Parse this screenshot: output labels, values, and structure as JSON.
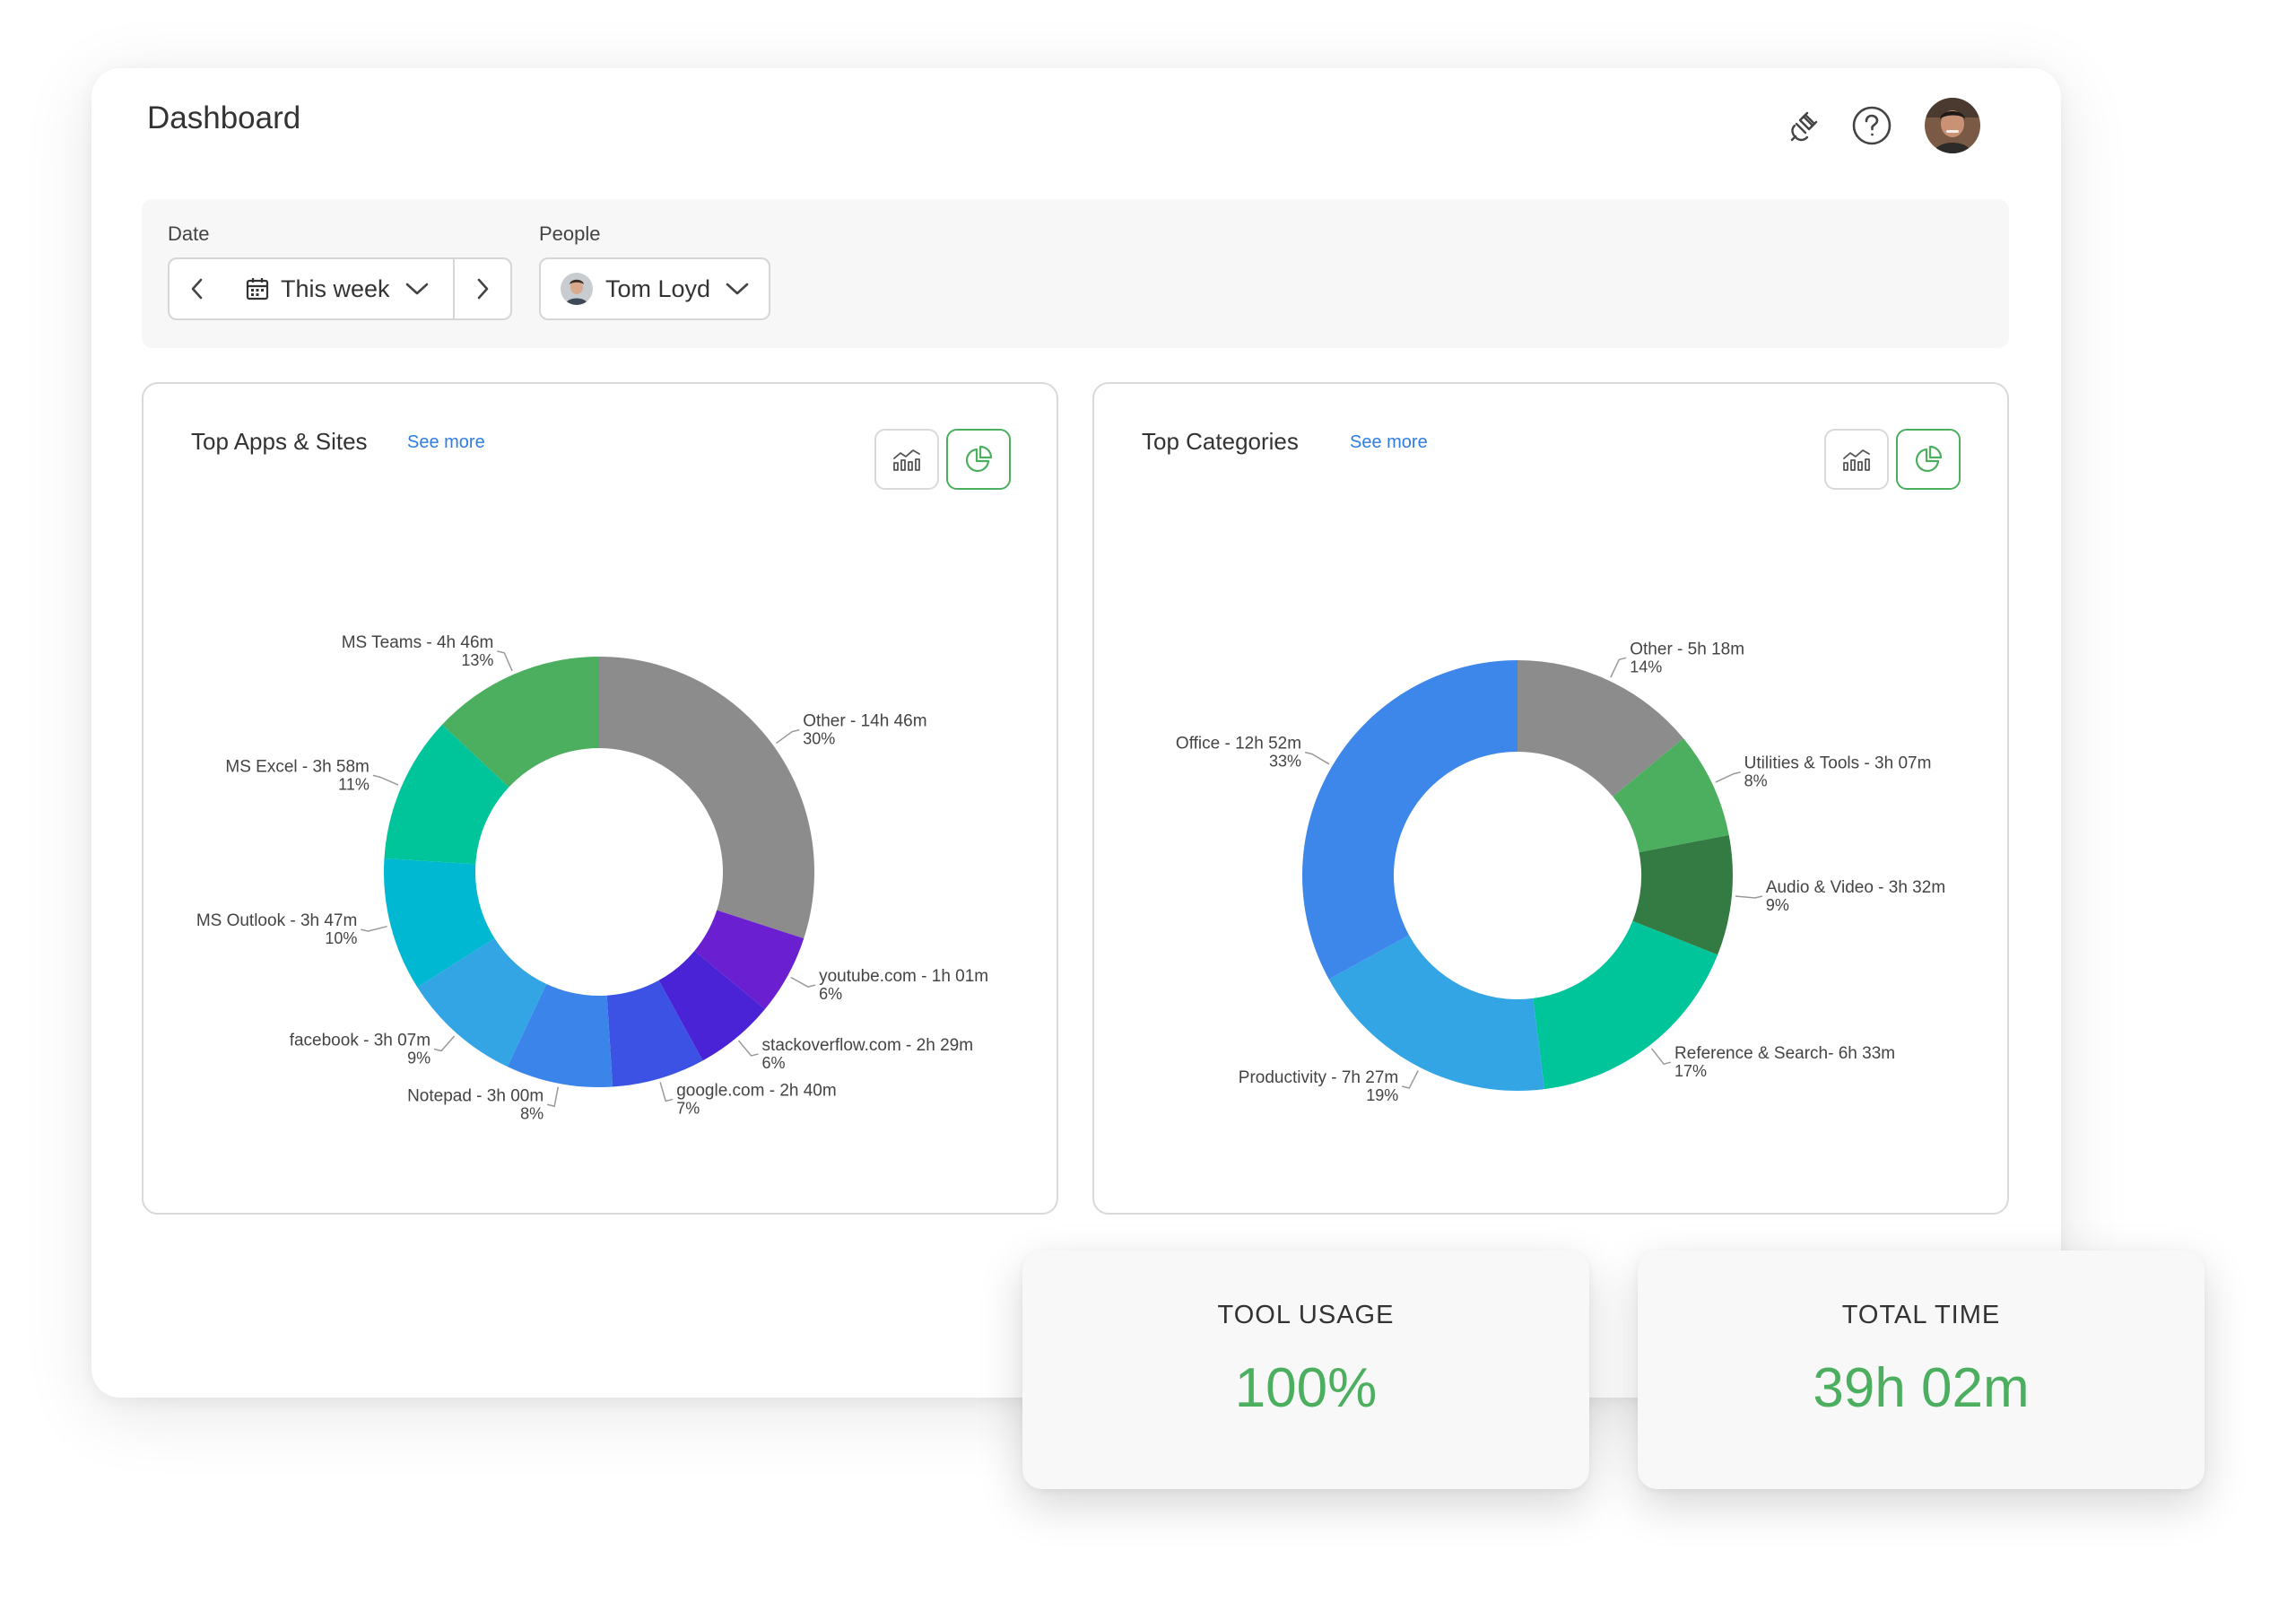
{
  "header": {
    "title": "Dashboard",
    "icons": [
      "plug-icon",
      "help-icon",
      "user-avatar"
    ]
  },
  "filters": {
    "date_label": "Date",
    "date_value": "This week",
    "people_label": "People",
    "people_value": "Tom Loyd"
  },
  "panels": [
    {
      "title": "Top Apps & Sites",
      "see_more": "See more"
    },
    {
      "title": "Top Categories",
      "see_more": "See more"
    }
  ],
  "chart_data": [
    {
      "type": "pie",
      "title": "Top Apps & Sites",
      "donut": true,
      "slices": [
        {
          "label": "Other - 14h 46m",
          "pct": "30%",
          "value": 30,
          "color": "#8c8c8c"
        },
        {
          "label": "youtube.com - 1h 01m",
          "pct": "6%",
          "value": 6,
          "color": "#6a1fd1"
        },
        {
          "label": "stackoverflow.com - 2h 29m",
          "pct": "6%",
          "value": 6,
          "color": "#4a23d6"
        },
        {
          "label": "google.com - 2h 40m",
          "pct": "7%",
          "value": 7,
          "color": "#3b52e4"
        },
        {
          "label": "Notepad - 3h 00m",
          "pct": "8%",
          "value": 8,
          "color": "#3b84ea"
        },
        {
          "label": "facebook - 3h 07m",
          "pct": "9%",
          "value": 9,
          "color": "#34a5e4"
        },
        {
          "label": "MS Outlook - 3h 47m",
          "pct": "10%",
          "value": 10,
          "color": "#00b8d2"
        },
        {
          "label": "MS Excel - 3h 58m",
          "pct": "11%",
          "value": 11,
          "color": "#00c49a"
        },
        {
          "label": "MS Teams - 4h 46m",
          "pct": "13%",
          "value": 13,
          "color": "#4caf5f"
        }
      ]
    },
    {
      "type": "pie",
      "title": "Top Categories",
      "donut": true,
      "slices": [
        {
          "label": "Other - 5h 18m",
          "pct": "14%",
          "value": 14,
          "color": "#8c8c8c"
        },
        {
          "label": "Utilities & Tools - 3h 07m",
          "pct": "8%",
          "value": 8,
          "color": "#4caf5f"
        },
        {
          "label": "Audio & Video - 3h 32m",
          "pct": "9%",
          "value": 9,
          "color": "#347a43"
        },
        {
          "label": "Reference & Search- 6h 33m",
          "pct": "17%",
          "value": 17,
          "color": "#00c49a"
        },
        {
          "label": "Productivity - 7h 27m",
          "pct": "19%",
          "value": 19,
          "color": "#34a5e4"
        },
        {
          "label": "Office - 12h 52m",
          "pct": "33%",
          "value": 33,
          "color": "#3d86ea"
        }
      ]
    }
  ],
  "stats": [
    {
      "label": "TOOL USAGE",
      "value": "100%"
    },
    {
      "label": "TOTAL TIME",
      "value": "39h 02m"
    }
  ],
  "colors": {
    "accent_green": "#4caf5f",
    "link_blue": "#2f7de1",
    "border": "#d9d9d9"
  }
}
